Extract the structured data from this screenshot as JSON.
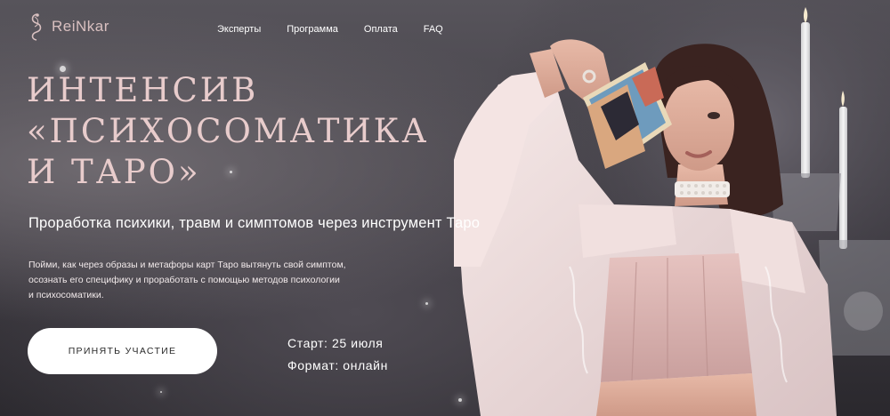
{
  "logo": {
    "text": "ReiNkar",
    "icon": "snake-logo-icon"
  },
  "nav": {
    "items": [
      "Эксперты",
      "Программа",
      "Оплата",
      "FAQ"
    ]
  },
  "hero": {
    "title_lines": [
      "ИНТЕНСИВ",
      "«ПСИХОСОМАТИКА",
      "И ТАРО»"
    ],
    "subtitle": "Проработка психики, травм и симптомов через инструмент Таро",
    "description_lines": [
      "Пойми, как через образы и метафоры карт Таро вытянуть свой симптом,",
      "осознать его специфику и проработать с помощью методов психологии",
      "и психосоматики."
    ],
    "cta_label": "ПРИНЯТЬ УЧАСТИЕ"
  },
  "info": {
    "items": [
      "Старт: 25 июля",
      "Формат: онлайн"
    ],
    "icon": "crescent-moon-icon"
  },
  "colors": {
    "accent": "#e8cccc",
    "moon": "#e6c6c4",
    "button_bg": "#ffffff"
  }
}
